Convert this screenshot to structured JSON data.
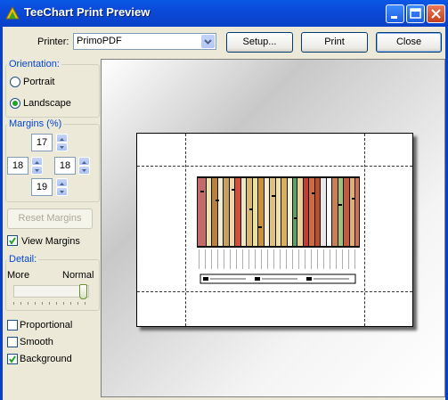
{
  "window": {
    "title": "TeeChart Print Preview"
  },
  "toolbar": {
    "printer_label": "Printer:",
    "printer_value": "PrimoPDF",
    "setup_label": "Setup...",
    "print_label": "Print",
    "close_label": "Close"
  },
  "orientation": {
    "title": "Orientation:",
    "portrait_label": "Portrait",
    "landscape_label": "Landscape",
    "selected": "Landscape"
  },
  "margins": {
    "title": "Margins (%)",
    "top": "17",
    "left": "18",
    "right": "18",
    "bottom": "19",
    "reset_label": "Reset Margins"
  },
  "view_margins": {
    "label": "View Margins",
    "checked": true
  },
  "detail": {
    "title": "Detail:",
    "more_label": "More",
    "normal_label": "Normal",
    "level": 1.0
  },
  "options": {
    "proportional": {
      "label": "Proportional",
      "checked": false
    },
    "smooth": {
      "label": "Smooth",
      "checked": false
    },
    "background": {
      "label": "Background",
      "checked": true
    }
  },
  "colors": {
    "title_bar": "#0a58e6",
    "group_title": "#0046d5",
    "check_mark": "#21a121"
  }
}
